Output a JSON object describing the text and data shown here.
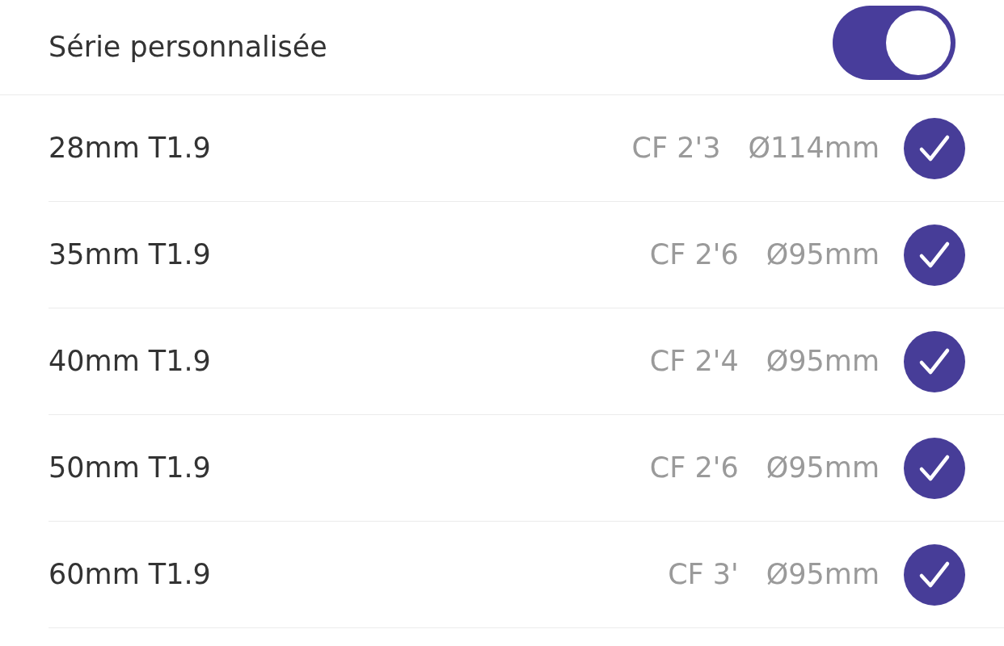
{
  "header": {
    "label": "Série personnalisée",
    "on": true
  },
  "lenses": [
    {
      "name": "28mm T1.9",
      "focus": "CF 2'3",
      "diameter": "Ø114mm",
      "checked": true
    },
    {
      "name": "35mm T1.9",
      "focus": "CF 2'6",
      "diameter": "Ø95mm",
      "checked": true
    },
    {
      "name": "40mm T1.9",
      "focus": "CF 2'4",
      "diameter": "Ø95mm",
      "checked": true
    },
    {
      "name": "50mm T1.9",
      "focus": "CF 2'6",
      "diameter": "Ø95mm",
      "checked": true
    },
    {
      "name": "60mm T1.9",
      "focus": "CF 3'",
      "diameter": "Ø95mm",
      "checked": true
    }
  ]
}
